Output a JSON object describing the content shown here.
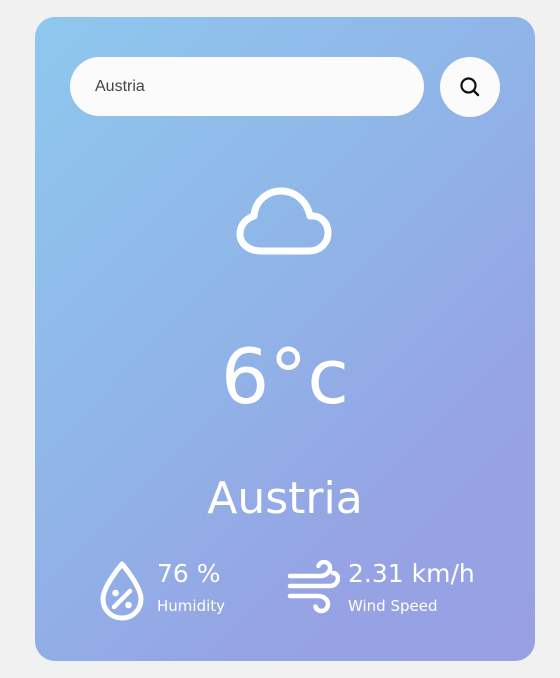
{
  "search": {
    "value": "Austria",
    "button_icon": "search-icon"
  },
  "weather": {
    "icon": "cloud-icon",
    "temperature": "6°c",
    "city": "Austria"
  },
  "details": {
    "humidity": {
      "icon": "humidity-drop-icon",
      "value": "76 %",
      "label": "Humidity"
    },
    "wind": {
      "icon": "wind-icon",
      "value": "2.31 km/h",
      "label": "Wind Speed"
    }
  },
  "colors": {
    "card_gradient_start": "#8ec8ee",
    "card_gradient_end": "#98a0e3",
    "text": "#ffffff",
    "input_background": "#fbfbfb"
  }
}
